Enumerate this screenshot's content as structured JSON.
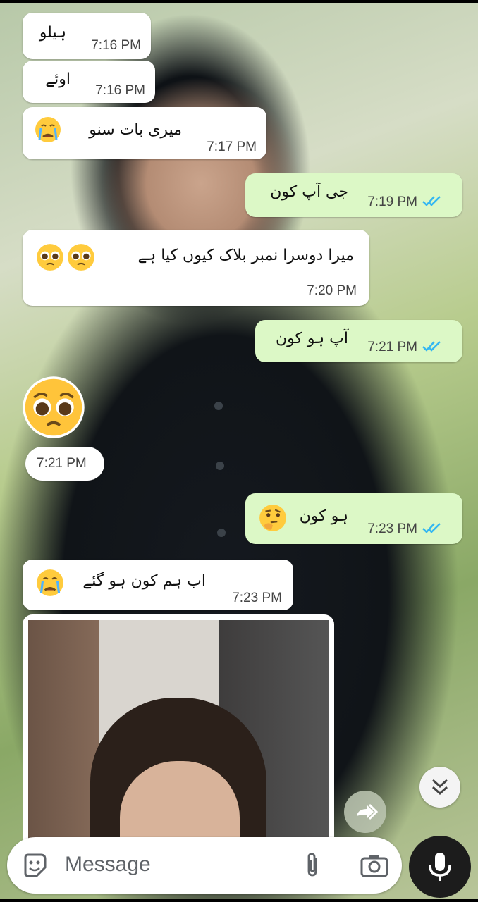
{
  "chat": {
    "messages": [
      {
        "dir": "in",
        "text": "ہیلو",
        "time": "7:16 PM"
      },
      {
        "dir": "in",
        "text": "اوئے",
        "time": "7:16 PM"
      },
      {
        "dir": "in",
        "text": "میری بات سنو",
        "time": "7:17 PM",
        "emoji": "crying-face"
      },
      {
        "dir": "out",
        "text": "جی آپ کون",
        "time": "7:19 PM",
        "status": "read"
      },
      {
        "dir": "in",
        "text": "میرا دوسرا نمبر بلاک کیوں کیا ہے",
        "time": "7:20 PM",
        "emoji": "pleading-face-x2"
      },
      {
        "dir": "out",
        "text": "آپ ہو کون",
        "time": "7:21 PM",
        "status": "read"
      },
      {
        "dir": "in",
        "sticker": "pleading-face",
        "time": "7:21 PM"
      },
      {
        "dir": "out",
        "text": "ہو کون",
        "time": "7:23 PM",
        "status": "read",
        "emoji": "thinking-face"
      },
      {
        "dir": "in",
        "text": "اب ہم کون ہو گئے",
        "time": "7:23 PM",
        "emoji": "crying-face"
      },
      {
        "dir": "in",
        "media": "photo"
      }
    ]
  },
  "composer": {
    "placeholder": "Message",
    "emoji_icon": "sticker-icon",
    "attach_icon": "paperclip-icon",
    "camera_icon": "camera-icon",
    "mic_icon": "microphone-icon"
  },
  "controls": {
    "scroll_down_icon": "double-chevron-down-icon",
    "forward_icon": "forward-icon"
  },
  "colors": {
    "incoming": "#ffffff",
    "outgoing": "#dcf8c6",
    "read_ticks": "#34b7f1",
    "mic_button": "#1c1c1c"
  }
}
